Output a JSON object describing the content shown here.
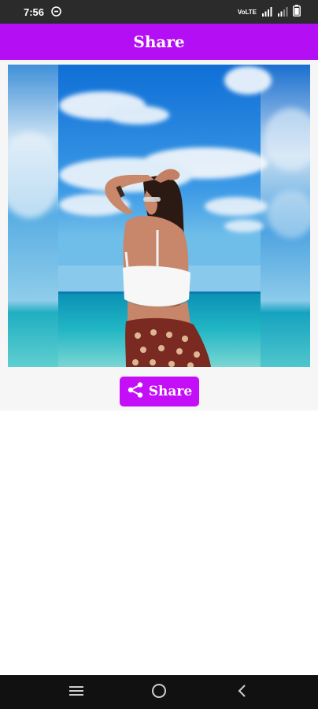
{
  "status_bar": {
    "time": "7:56",
    "network_label": "VoLTE",
    "icons": [
      "data-saver-icon",
      "signal-icon",
      "signal-icon",
      "battery-icon"
    ]
  },
  "app_bar": {
    "title": "Share"
  },
  "main": {
    "image": {
      "icon": "photo-image",
      "description_icon": "beach-photo"
    },
    "share_button": {
      "label": "Share",
      "icon": "share-icon"
    }
  },
  "nav_bar": {
    "icons": [
      "recents-icon",
      "home-icon",
      "back-icon"
    ]
  },
  "colors": {
    "app_bar": "#b40ef5",
    "share_button": "#c30ef7",
    "status_bar": "#2b2b2b",
    "nav_bar": "#111111"
  }
}
